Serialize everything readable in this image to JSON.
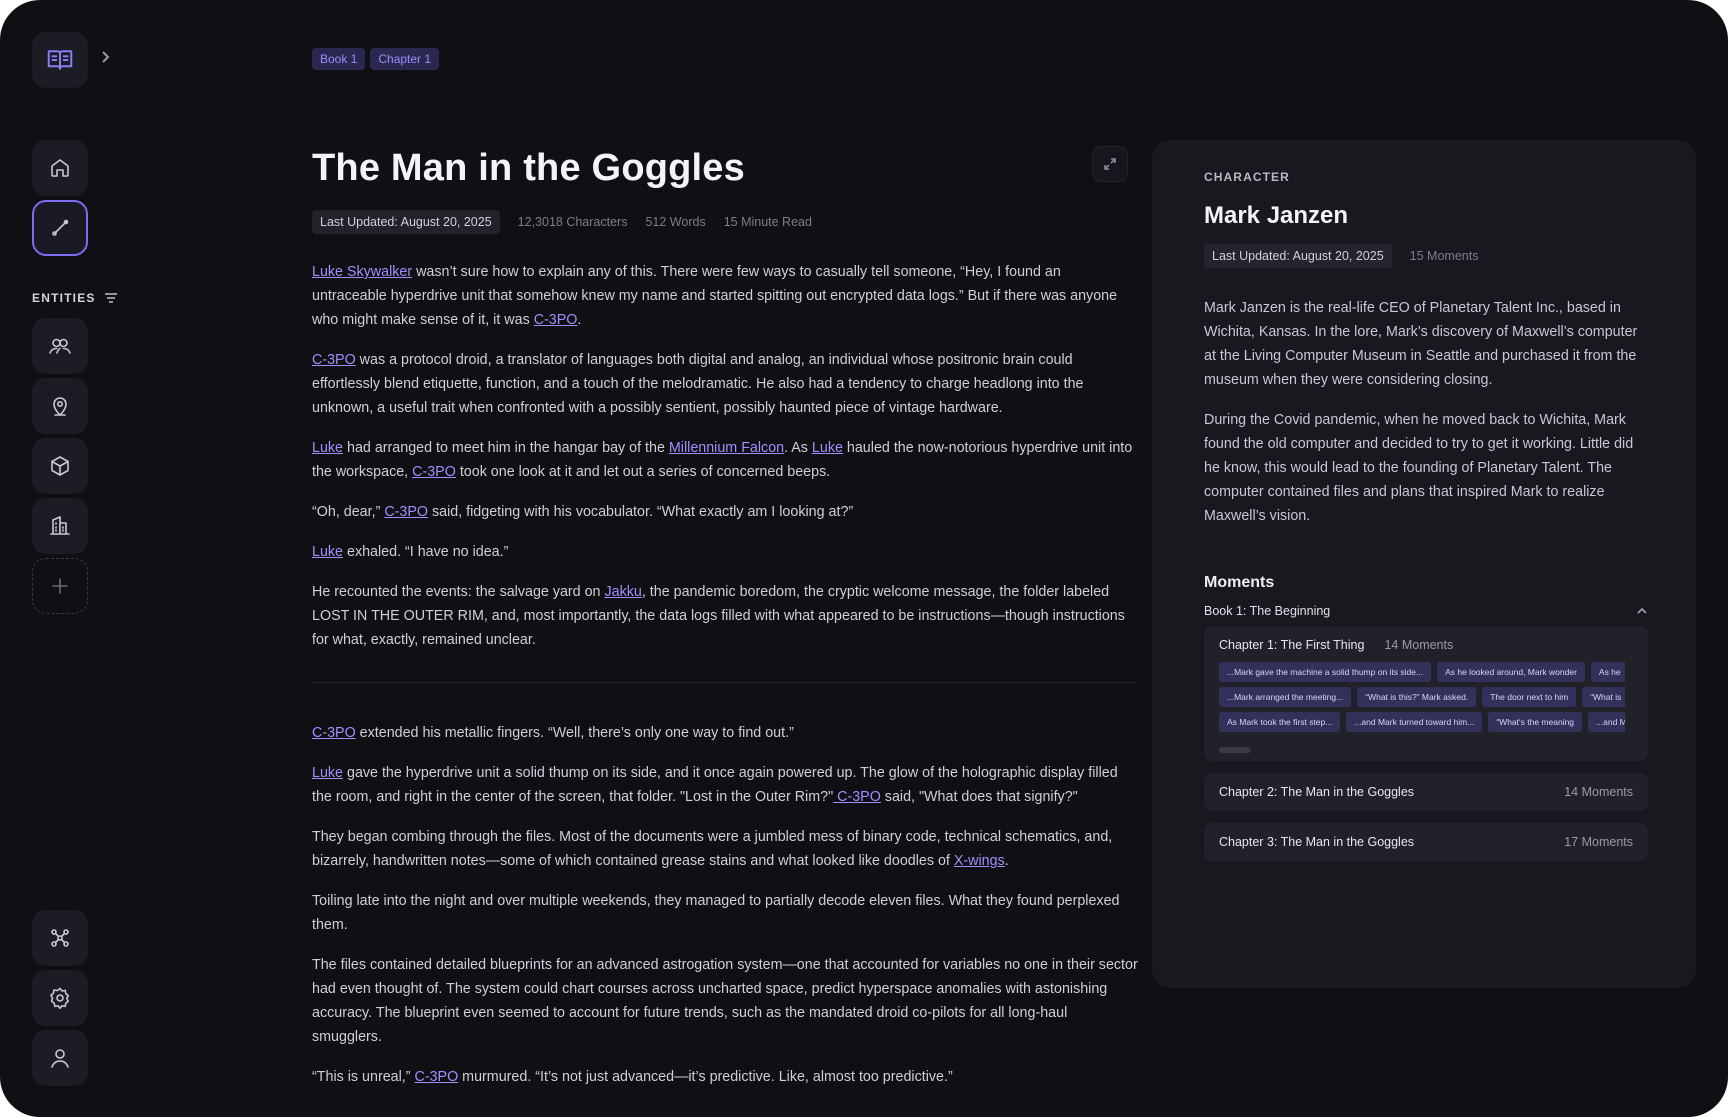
{
  "breadcrumbs": [
    "Book 1",
    "Chapter 1"
  ],
  "sidebar": {
    "entities_label": "ENTITIES",
    "top_items": [
      {
        "name": "home",
        "icon": "home-icon"
      },
      {
        "name": "write",
        "icon": "pen-icon",
        "active": true
      }
    ],
    "entity_items": [
      {
        "name": "characters",
        "icon": "users-icon"
      },
      {
        "name": "locations",
        "icon": "map-pin-icon"
      },
      {
        "name": "items",
        "icon": "cube-icon"
      },
      {
        "name": "organizations",
        "icon": "building-icon"
      },
      {
        "name": "add-entity",
        "icon": "plus-icon"
      }
    ],
    "bottom_items": [
      {
        "name": "graph",
        "icon": "graph-icon"
      },
      {
        "name": "settings",
        "icon": "gear-icon"
      },
      {
        "name": "profile",
        "icon": "user-icon"
      }
    ]
  },
  "article": {
    "title": "The Man in the Goggles",
    "last_updated": "Last Updated: August 20, 2025",
    "characters": "12,3018 Characters",
    "words": "512 Words",
    "read_time": "15 Minute Read"
  },
  "panel": {
    "eyebrow": "CHARACTER",
    "name": "Mark Janzen",
    "last_updated": "Last Updated: August 20, 2025",
    "moments_count": "15 Moments",
    "bio": [
      "Mark Janzen is the real-life CEO of Planetary Talent Inc., based in Wichita, Kansas. In the lore, Mark’s discovery of Maxwell’s computer at the Living Computer Museum in Seattle and purchased it from the museum when they were considering closing.",
      "During the Covid pandemic, when he moved back to Wichita, Mark found the old computer and decided to try to get it working. Little did he know, this would lead to the founding of Planetary Talent. The computer contained files and plans that inspired Mark to realize Maxwell’s vision."
    ],
    "moments_title": "Moments",
    "book_label": "Book 1: The Beginning",
    "open_chapter": {
      "title": "Chapter 1: The First Thing",
      "count": "14 Moments",
      "tag_rows": [
        [
          "...Mark gave the machine a solid thump on its side...",
          "As he looked around, Mark wonder",
          "As he"
        ],
        [
          "...Mark arranged the meeting...",
          "“What is this?” Mark asked.",
          "The door next to him",
          "“What is"
        ],
        [
          "As Mark took the first step...",
          "...and Mark turned toward him...",
          "“What's the meaning",
          "...and M"
        ]
      ]
    },
    "chapters": [
      {
        "title": "Chapter 2: The Man in the Goggles",
        "count": "14 Moments"
      },
      {
        "title": "Chapter 3: The Man in the Goggles",
        "count": "17 Moments"
      }
    ]
  },
  "colors": {
    "background": "#0f0f14",
    "panel": "#18181e",
    "accent": "#8b7ff5",
    "link": "#9d91ff"
  }
}
